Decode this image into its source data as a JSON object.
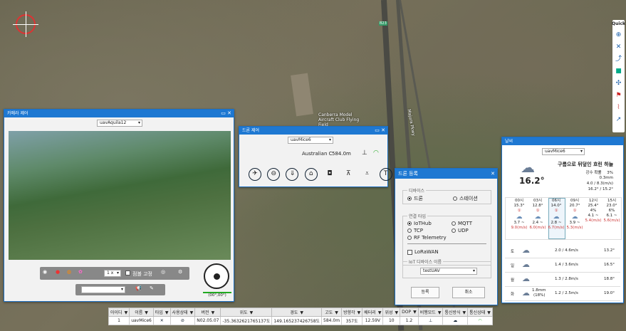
{
  "map": {
    "road_label": "B23",
    "place_label": "Canberra Model Aircraft Club Flying Field",
    "road_name": "Majura Pkwy"
  },
  "quick_toolbar": {
    "title": "Quick"
  },
  "camera_window": {
    "title": "카메라 제어",
    "drone_select": "uavAquila12",
    "zoom_value": "1 x",
    "fix_label": "점볼 고정",
    "gimbal_readout": "(00°,00°)"
  },
  "drone_window": {
    "title": "드론 제어",
    "drone_select": "uavMice6",
    "location": "Australian C",
    "altitude": "584.0m"
  },
  "register_window": {
    "title": "드론 등록",
    "device_group": "디바이스",
    "device_options": [
      "드론",
      "스테이션"
    ],
    "conn_group": "연결 타입",
    "conn_options": [
      "IoTHub",
      "MQTT",
      "TCP",
      "UDP",
      "RF Telemetry"
    ],
    "lorawan_label": "LoRaWAN",
    "iot_group": "IoT 디바이스 이름",
    "iot_value": "testUAV",
    "register_btn": "등록",
    "cancel_btn": "취소"
  },
  "weather_window": {
    "title": "날씨",
    "drone_select": "uavMice6",
    "temp": "16.2°",
    "condition": "구름으로 뒤덮인 흐린 하늘",
    "precip_label": "강수 확률",
    "precip_value": "3%",
    "precip_amount": "0.3mm",
    "wind": "4.0 / 8.3(m/s)",
    "temp_range": "16.2° / 15.2°",
    "hourly": [
      {
        "time": "00시",
        "temp": "15.3°",
        "wind": "3.7 ~",
        "gust": "9.0(m/s)"
      },
      {
        "time": "03시",
        "temp": "12.8°",
        "wind": "2.4 ~",
        "gust": "6.0(m/s)"
      },
      {
        "time": "06시",
        "temp": "14.0°",
        "wind": "2.8 ~",
        "gust": "6.7(m/s)"
      },
      {
        "time": "09시",
        "temp": "20.7°",
        "wind": "3.9 ~",
        "gust": "5.3(m/s)"
      },
      {
        "time": "12시",
        "temp": "25.4°",
        "precip": "4%",
        "wind": "4.1 ~",
        "gust": "5.4(m/s)"
      },
      {
        "time": "15시",
        "temp": "23.0°",
        "precip": "6%",
        "wind": "6.1 ~",
        "gust": "5.6(m/s)"
      }
    ],
    "daily": [
      {
        "day": "토",
        "wind": "2.0 / 4.6m/s",
        "temp": "13.2°"
      },
      {
        "day": "일",
        "wind": "1.4 / 3.6m/s",
        "temp": "16.5°"
      },
      {
        "day": "월",
        "wind": "1.3 / 2.8m/s",
        "temp": "18.8°"
      },
      {
        "day": "화",
        "precip": "1.8mm",
        "precip_pct": "(18%)",
        "wind": "1.2 / 2.5m/s",
        "temp": "19.0°"
      }
    ]
  },
  "status_table": {
    "headers": [
      "아이디",
      "이름",
      "타입",
      "사용상태",
      "버전",
      "위도",
      "경도",
      "고도",
      "방향각",
      "배터리",
      "위성",
      "DOP",
      "비행모드",
      "통신방식",
      "통신상태"
    ],
    "row": [
      "1",
      "uavMice6",
      "",
      "",
      "N02.05.07",
      "-35.3632621765137도",
      "149.165237426758도",
      "584.0m",
      "357도",
      "12.59V",
      "10",
      "1.2",
      "",
      "",
      ""
    ]
  }
}
